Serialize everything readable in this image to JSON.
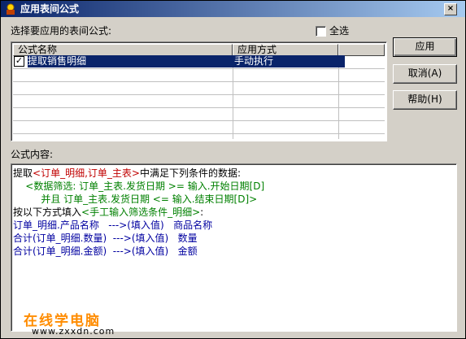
{
  "window": {
    "title": "应用表间公式",
    "close_glyph": "×"
  },
  "select_label": "选择要应用的表间公式:",
  "select_all_label": "全选",
  "list": {
    "columns": [
      "公式名称",
      "应用方式"
    ],
    "rows": [
      {
        "checked": true,
        "check_glyph": "✓",
        "name": "提取销售明细",
        "method": "手动执行"
      }
    ]
  },
  "buttons": {
    "apply": "应用",
    "cancel": "取消(A)",
    "help": "帮助(H)"
  },
  "content_label": "公式内容:",
  "formula": {
    "l1_a": "提取",
    "l1_b": "<订单_明细,订单_主表>",
    "l1_c": "中满足下列条件的数据:",
    "l2_a": "    ",
    "l2_b": "<数据筛选: 订单_主表.发货日期 >= 输入.开始日期[D]",
    "l3_a": "         ",
    "l3_b": "并且 订单_主表.发货日期 <= 输入.结束日期[D]>",
    "l4_a": "按以下方式填入",
    "l4_b": "<手工输入筛选条件_明细>",
    "l4_c": ":",
    "l5": "订单_明细.产品名称   --->(填入值)   商品名称",
    "l6": "合计(订单_明细.数量)  --->(填入值)   数量",
    "l7": "合计(订单_明细.金额)  --->(填入值)   金额"
  },
  "watermark": {
    "title": "在线学电脑",
    "url": "www.zxxdn.com"
  }
}
